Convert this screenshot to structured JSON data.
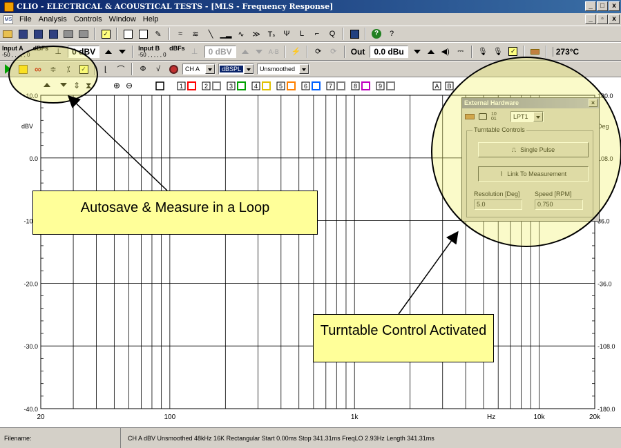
{
  "window": {
    "title": "CLIO - ELECTRICAL & ACOUSTICAL TESTS - [MLS - Frequency Response]",
    "controls": [
      "_",
      "□",
      "x"
    ],
    "mdi_controls": [
      "_",
      "▫",
      "x"
    ]
  },
  "menu": {
    "doc_icon_label": "MS",
    "items": [
      "File",
      "Analysis",
      "Controls",
      "Window",
      "Help"
    ]
  },
  "toolbar2": {
    "input_a_label": "Input A",
    "input_a_unit": "dBFs",
    "input_a_scale": "-50 , , , , , 0",
    "input_a_value": "0 dBV",
    "input_b_label": "Input B",
    "input_b_unit": "dBFs",
    "input_b_scale": "-50 , , , , , 0",
    "input_b_value": "0 dBV",
    "ab_label": "A-B",
    "out_label": "Out",
    "out_value": "0.0 dBu",
    "temperature": "273°C"
  },
  "toolbar3": {
    "channel": "CH A",
    "unit": "dBSPL",
    "smoothing": "Unsmoothed"
  },
  "graph_toolbar": {
    "curve_numbers": [
      "1",
      "2",
      "3",
      "4",
      "5",
      "6",
      "7",
      "8",
      "9"
    ],
    "curve_colors": [
      "#ff0000",
      "#808080",
      "#00a000",
      "#e0c000",
      "#ff8000",
      "#0060ff",
      "#808080",
      "#c000c0",
      "#808080"
    ],
    "ab_buttons": [
      "A",
      "B"
    ]
  },
  "graph": {
    "y_left_label": "dBV",
    "y_left_ticks": [
      "10.0",
      "0.0",
      "-10.0",
      "-20.0",
      "-30.0",
      "-40.0"
    ],
    "y_right_label": "Deg",
    "y_right_ticks": [
      "180.0",
      "108.0",
      "36.0",
      "-36.0",
      "-108.0",
      "-180.0"
    ],
    "x_ticks": [
      "20",
      "100",
      "1k",
      "Hz",
      "10k",
      "20k"
    ]
  },
  "external_hardware": {
    "title": "External Hardware",
    "port": "LPT1",
    "group_label": "Turntable Controls",
    "single_pulse": "Single Pulse",
    "link_to_measurement": "Link To Measurement",
    "resolution_label": "Resolution [Deg]",
    "resolution_value": "5.0",
    "speed_label": "Speed [RPM]",
    "speed_value": "0.750",
    "bits_label": "10 01"
  },
  "callouts": {
    "autosave": "Autosave & Measure in a Loop",
    "turntable": "Turntable Control Activated"
  },
  "status": {
    "filename_label": "Filename:",
    "info": "CH A  dBV  Unsmoothed  48kHz  16K  Rectangular  Start 0.00ms  Stop 341.31ms  FreqLO 2.93Hz  Length 341.31ms"
  },
  "colors": {
    "titlebar": "#0a246a",
    "face": "#d4d0c8",
    "highlight": "#ffff99"
  }
}
